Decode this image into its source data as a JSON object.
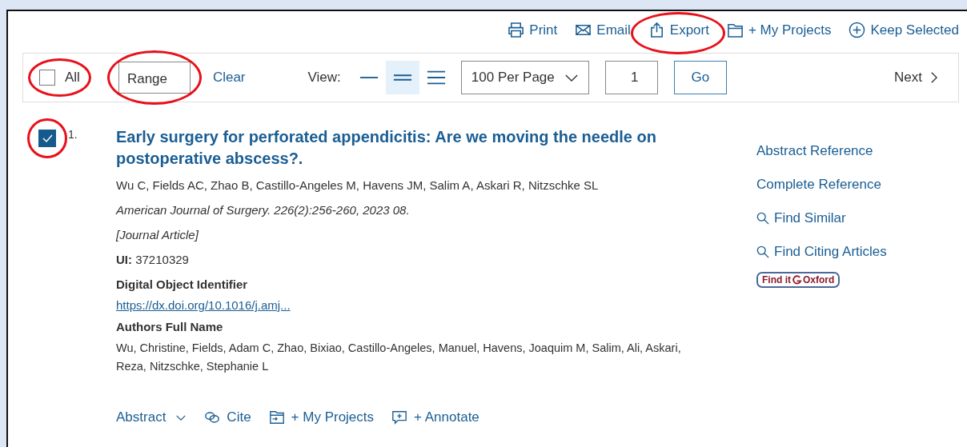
{
  "actions": [
    {
      "label": "Print",
      "kind": "print",
      "circled": false
    },
    {
      "label": "Email",
      "kind": "email",
      "circled": false
    },
    {
      "label": "Export",
      "kind": "export",
      "circled": true
    },
    {
      "label": "+ My Projects",
      "kind": "folder",
      "circled": false
    },
    {
      "label": "Keep Selected",
      "kind": "plus-circle",
      "circled": false
    }
  ],
  "toolbar": {
    "select_all": {
      "label": "All",
      "checked": false,
      "circled": true
    },
    "range": {
      "placeholder": "Range",
      "circled": true
    },
    "clear": "Clear",
    "view_label": "View:",
    "views": [
      {
        "kind": "one",
        "selected": false
      },
      {
        "kind": "two",
        "selected": true
      },
      {
        "kind": "three",
        "selected": false
      }
    ],
    "per_page": "100 Per Page",
    "page": "1",
    "go": "Go",
    "next": "Next"
  },
  "results": [
    {
      "number": "1.",
      "checked": true,
      "circled": true,
      "title": "Early surgery for perforated appendicitis: Are we moving the needle on postoperative abscess?.",
      "authors": "Wu C, Fields AC, Zhao B, Castillo-Angeles M, Havens JM, Salim A, Askari R, Nitzschke SL",
      "source": "American Journal of Surgery. 226(2):256-260, 2023 08.",
      "type": "[Journal Article]",
      "ui_label": "UI:",
      "ui": "37210329",
      "doi_label": "Digital Object Identifier",
      "doi": "https://dx.doi.org/10.1016/j.amj...",
      "full_names_label": "Authors Full Name",
      "full_names": "Wu, Christine, Fields, Adam C, Zhao, Bixiao, Castillo-Angeles, Manuel, Havens, Joaquim M, Salim, Ali, Askari, Reza, Nitzschke, Stephanie L",
      "links": [
        {
          "label": "Abstract Reference",
          "kind": "plain"
        },
        {
          "label": "Complete Reference",
          "kind": "plain"
        },
        {
          "label": "Find Similar",
          "kind": "search"
        },
        {
          "label": "Find Citing Articles",
          "kind": "search"
        }
      ],
      "badge": {
        "left": "Find it",
        "right": "Oxford"
      },
      "footer": [
        {
          "label": "Abstract",
          "kind": "caret"
        },
        {
          "label": "Cite",
          "kind": "cite"
        },
        {
          "label": "+ My Projects",
          "kind": "folder-arrow"
        },
        {
          "label": "+ Annotate",
          "kind": "comment-plus"
        }
      ]
    }
  ]
}
